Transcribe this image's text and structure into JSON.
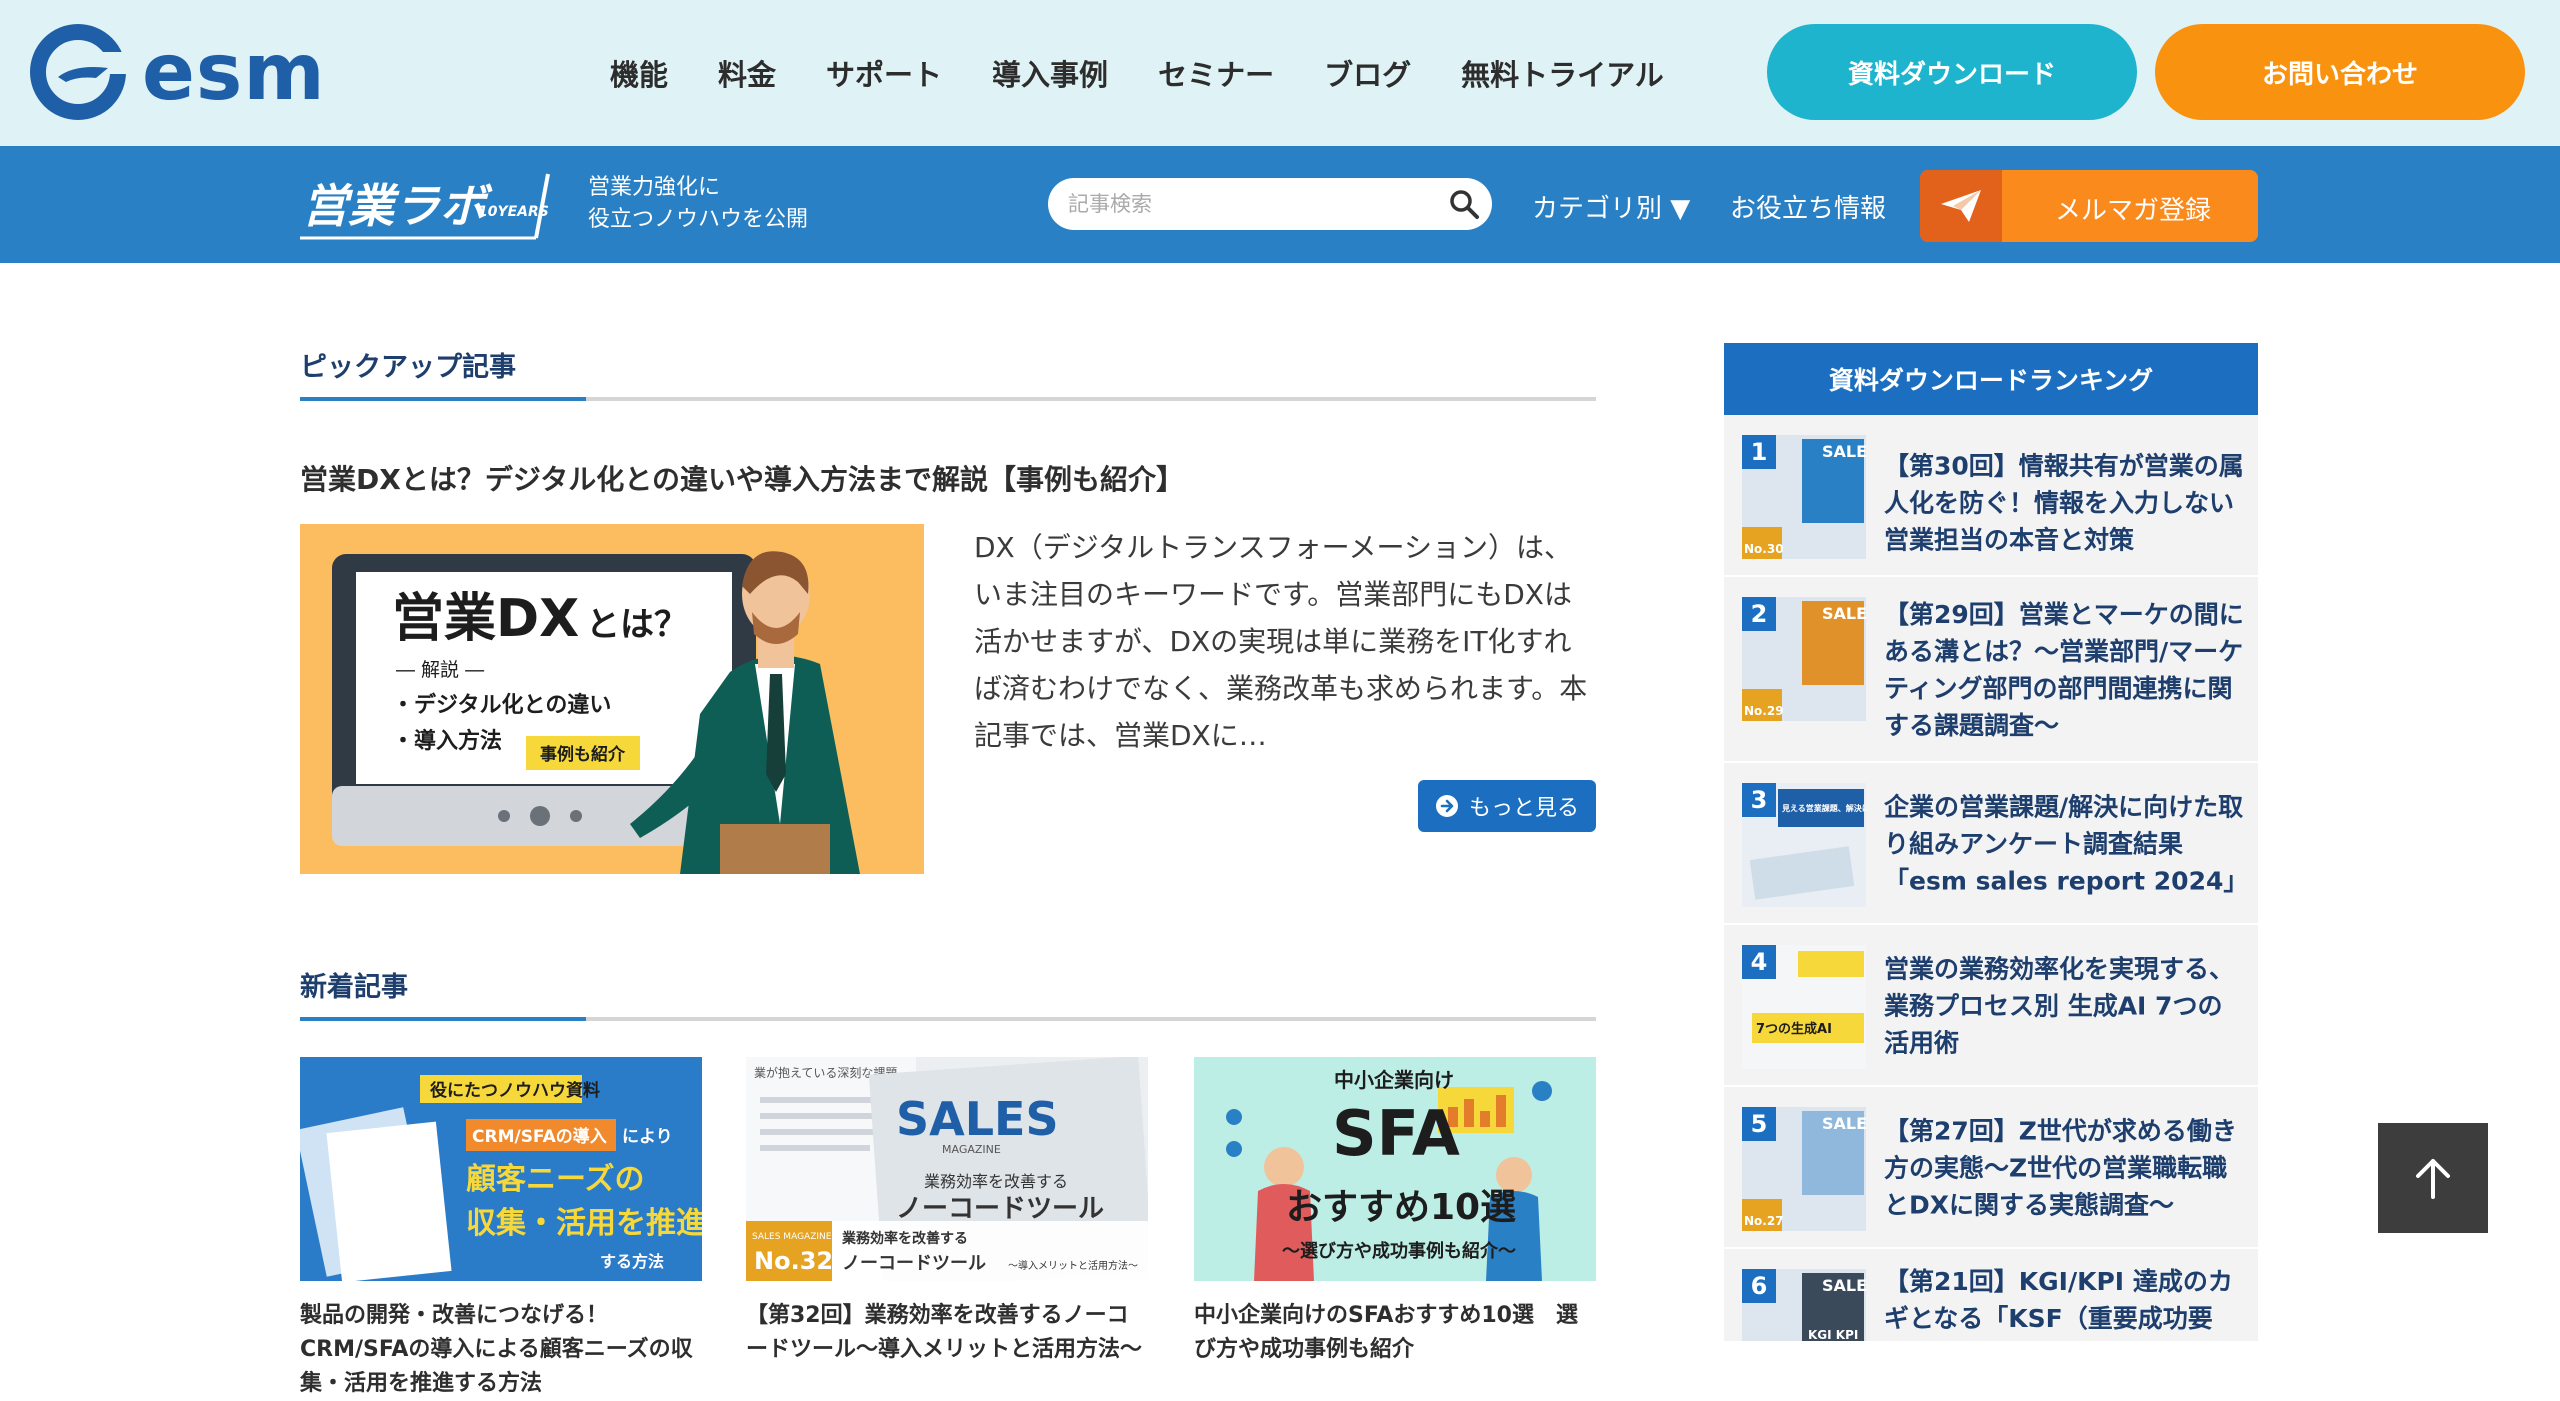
{
  "header": {
    "logo_text": "esm",
    "nav": [
      "機能",
      "料金",
      "サポート",
      "導入事例",
      "セミナー",
      "ブログ",
      "無料トライアル"
    ],
    "download_label": "資料ダウンロード",
    "contact_label": "お問い合わせ"
  },
  "labbar": {
    "logo_text": "営業ラボ",
    "logo_badge": "10YEARS",
    "tagline_1": "営業力強化に",
    "tagline_2": "役立つノウハウを公開",
    "search_placeholder": "記事検索",
    "category_label": "カテゴリ別 ▼",
    "info_label": "お役立ち情報",
    "mail_label": "メルマガ登録"
  },
  "pickup": {
    "heading": "ピックアップ記事",
    "title": "営業DXとは？デジタル化との違いや導入方法まで解説【事例も紹介】",
    "excerpt": "DX（デジタルトランスフォーメーション）は、いま注目のキーワードです。営業部門にもDXは活かせますが、DXの実現は単に業務をIT化すれば済むわけでなく、業務改革も求められます。本記事では、営業DXに…",
    "more_label": "もっと見る",
    "image": {
      "headline_a": "営業DX",
      "headline_b": "とは？",
      "sub": "― 解説 ―",
      "point_1": "・デジタル化との違い",
      "point_2": "・導入方法",
      "badge": "事例も紹介"
    }
  },
  "latest": {
    "heading": "新着記事",
    "cards": [
      {
        "title": "製品の開発・改善につなげる！CRM/SFAの導入による顧客ニーズの収集・活用を推進する方法",
        "thumb": {
          "tag": "役にたつノウハウ資料",
          "label_a": "CRM/SFAの導入",
          "label_b": "により",
          "line_1": "顧客ニーズの",
          "line_2": "収集・活用を推進",
          "tail": "する方法"
        }
      },
      {
        "title": "【第32回】業務効率を改善するノーコードツール〜導入メリットと活用方法〜",
        "thumb": {
          "brand": "SALES",
          "brand_sub": "MAGAZINE",
          "line_a": "業務効率を改善する",
          "line_b": "ノーコードツール",
          "line_c": "〜導入メリットと活用方法〜",
          "issue_label": "SALES MAGAZINE",
          "issue_no": "No.32",
          "top_text": "業が抱えている深刻な課題"
        }
      },
      {
        "title": "中小企業向けのSFAおすすめ10選　選び方や成功事例も紹介",
        "thumb": {
          "line_1": "中小企業向け",
          "line_2": "SFA",
          "line_3": "おすすめ10選",
          "line_4": "〜選び方や成功事例も紹介〜"
        }
      }
    ]
  },
  "ranking": {
    "heading": "資料ダウンロードランキング",
    "items": [
      {
        "rank": "1",
        "title": "【第30回】情報共有が営業の属人化を防ぐ！情報を入力しない営業担当の本音と対策",
        "thumb_text": "SALES",
        "issue": "No.30"
      },
      {
        "rank": "2",
        "title": "【第29回】営業とマーケの間にある溝とは？〜営業部門/マーケティング部門の部門間連携に関する課題調査〜",
        "thumb_text": "SALES",
        "issue": "No.29"
      },
      {
        "rank": "3",
        "title": "企業の営業課題/解決に向けた取り組みアンケート調査結果「esm sales report 2024」",
        "thumb_text": "見える営業課題、解決に向けた取組み",
        "issue": ""
      },
      {
        "rank": "4",
        "title": "営業の業務効率化を実現する、業務プロセス別 生成AI 7つの活用術",
        "thumb_text": "7つの生成AI",
        "issue": ""
      },
      {
        "rank": "5",
        "title": "【第27回】Z世代が求める働き方の実態〜Z世代の営業職転職とDXに関する実態調査〜",
        "thumb_text": "SALES",
        "issue": "No.27"
      },
      {
        "rank": "6",
        "title": "【第21回】KGI/KPI 達成のカギとなる「KSF（重要成功要",
        "thumb_text": "SALES",
        "issue": "KGI KPI"
      }
    ]
  },
  "colors": {
    "header_bg": "#dff2f5",
    "labbar_bg": "#2a80c4",
    "accent_blue": "#1c6fc0",
    "cyan_button": "#1fb4ce",
    "orange_button": "#f9920f"
  },
  "icons": [
    "esm-logo-icon",
    "search-icon",
    "paper-plane-icon",
    "arrow-circle-icon",
    "arrow-up-icon"
  ]
}
